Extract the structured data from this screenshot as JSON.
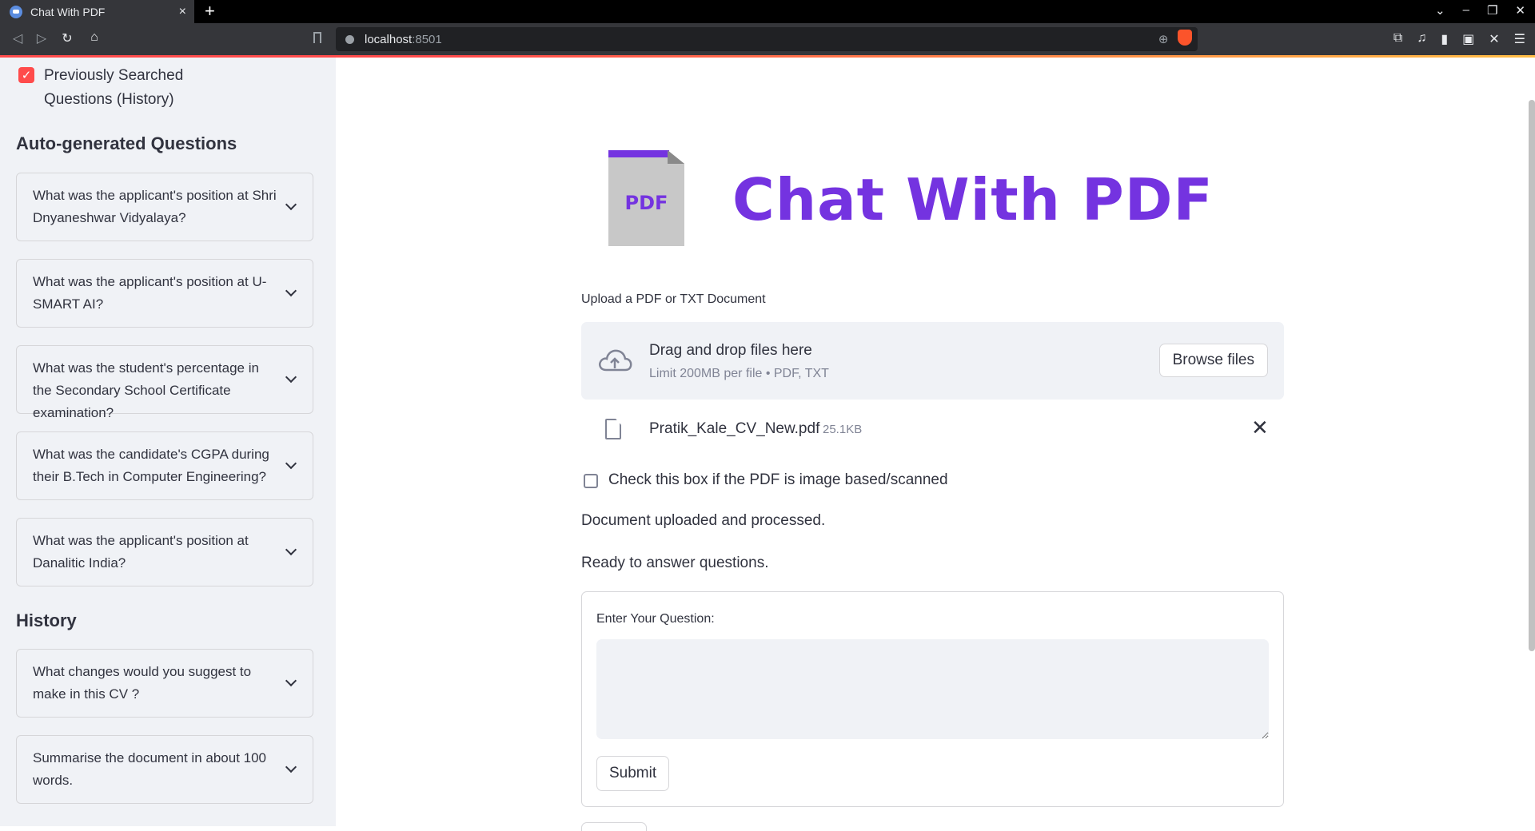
{
  "browser": {
    "tab_title": "Chat With PDF",
    "tab_close": "×",
    "new_tab": "+",
    "url_host": "localhost",
    "url_port": ":8501"
  },
  "sidebar": {
    "history_checkbox_label": "Previously Searched Questions (History)",
    "history_checked": true,
    "auto_heading": "Auto-generated Questions",
    "auto_questions": [
      "What was the applicant's position at Shri Dnyaneshwar Vidyalaya?",
      "What was the applicant's position at U-SMART AI?",
      "What was the student's percentage in the Secondary School Certificate examination?",
      "What was the candidate's CGPA during their B.Tech in Computer Engineering?",
      "What was the applicant's position at Danalitic India?"
    ],
    "history_heading": "History",
    "history_questions": [
      "What changes would you suggest to make in this CV ?",
      "Summarise the document in about 100 words."
    ]
  },
  "main": {
    "logo_label": "PDF",
    "title": "Chat With PDF",
    "upload_label": "Upload a PDF or TXT Document",
    "drop_title": "Drag and drop files here",
    "drop_sub": "Limit 200MB per file • PDF, TXT",
    "browse_label": "Browse files",
    "file_name": "Pratik_Kale_CV_New.pdf",
    "file_size": "25.1KB",
    "file_remove": "✕",
    "scan_label": "Check this box if the PDF is image based/scanned",
    "scan_checked": false,
    "status_processed": "Document uploaded and processed.",
    "status_ready": "Ready to answer questions.",
    "question_label": "Enter Your Question:",
    "question_value": "",
    "submit_label": "Submit"
  },
  "colors": {
    "accent": "#7433e0",
    "streamlit_red": "#ff4b4b",
    "sidebar_bg": "#f0f2f6",
    "text": "#31333f",
    "muted": "#808495"
  }
}
